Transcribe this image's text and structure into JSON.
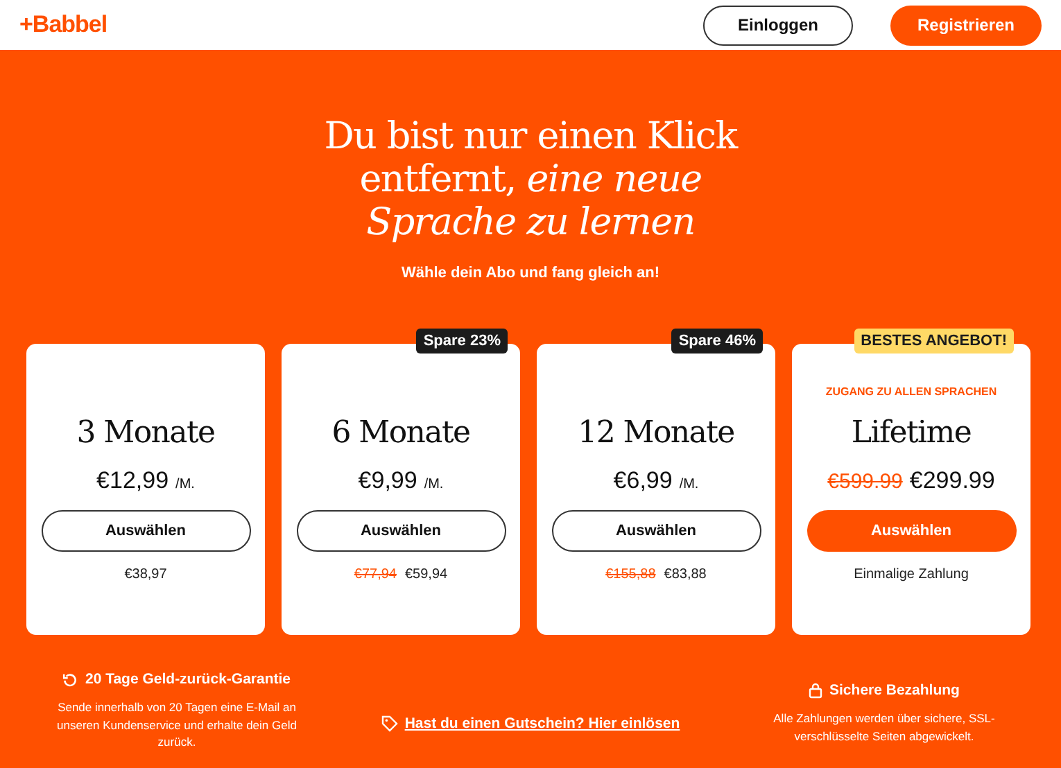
{
  "header": {
    "logo": "+Babbel",
    "login": "Einloggen",
    "register": "Registrieren"
  },
  "hero": {
    "title": "Du bist nur einen Klick entfernt, *eine neue Sprache zu lernen*",
    "subtitle": "Wähle dein Abo und fang gleich an!"
  },
  "plans": [
    {
      "name": "3 Monate",
      "price": "€12,99",
      "unit": "/M.",
      "button": "Auswählen",
      "featured": false,
      "total": "€38,97"
    },
    {
      "badge": {
        "text": "Spare 23%",
        "kind": "dark"
      },
      "name": "6 Monate",
      "price": "€9,99",
      "unit": "/M.",
      "button": "Auswählen",
      "featured": false,
      "old_total": "€77,94",
      "total": "€59,94"
    },
    {
      "badge": {
        "text": "Spare 46%",
        "kind": "dark"
      },
      "name": "12 Monate",
      "price": "€6,99",
      "unit": "/M.",
      "button": "Auswählen",
      "featured": false,
      "old_total": "€155,88",
      "total": "€83,88"
    },
    {
      "badge": {
        "text": "BESTES ANGEBOT!",
        "kind": "highlight"
      },
      "eyebrow": "ZUGANG ZU ALLEN SPRACHEN",
      "name": "Lifetime",
      "old_price": "€599.99",
      "price": "€299.99",
      "button": "Auswählen",
      "featured": true,
      "note": "Einmalige Zahlung"
    }
  ],
  "footer": {
    "guarantee": {
      "title": "20 Tage Geld-zurück-Garantie",
      "text": "Sende innerhalb von 20 Tagen eine E-Mail an unseren Kundenservice und erhalte dein Geld zurück."
    },
    "voucher": "Hast du einen Gutschein? Hier einlösen",
    "security": {
      "title": "Sichere Bezahlung",
      "text": "Alle Zahlungen werden über sichere, SSL-verschlüsselte Seiten abgewickelt."
    }
  }
}
